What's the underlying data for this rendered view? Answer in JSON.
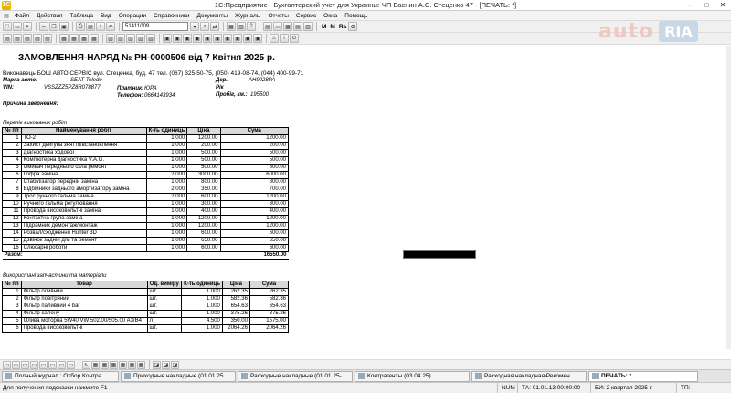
{
  "window": {
    "title": "1С:Предприятие - Бухгалтерский учет для Украины: ЧП Баснин А.С. Стеценко 47 - [ПЕЧАТЬ: *]"
  },
  "menu": [
    "Файл",
    "Действия",
    "Таблица",
    "Вид",
    "Операции",
    "Справочники",
    "Документы",
    "Журналы",
    "Отчеты",
    "Сервис",
    "Окна",
    "Помощь"
  ],
  "toolbar": {
    "search_value": "51411009",
    "font_m": "M",
    "font_m2": "M",
    "font_ra": "Ra"
  },
  "watermark": {
    "text1": "auto",
    "text2": "RIA"
  },
  "document": {
    "title": "ЗАМОВЛЕННЯ-НАРЯД  № РН-0000506  від 7 Квітня 2025 р.",
    "executor": "Виконавець БОШ АВТО СЕРВІС вул. Стеценка, буд. 47 тел. (067) 325-50-75, (050) 419-08-74, (044) 400-99-71",
    "car_label": "Марка авто:",
    "car_value": "SEAT Toledo",
    "vin_label": "VIN:",
    "vin_value": "VSSZZZ5PZ8R078877",
    "payer_label": "Платник:",
    "payer_value": "ЮРА",
    "phone_label": "Телефон:",
    "phone_value": "0664143934",
    "reg_label": "Дер.",
    "reg_value": "AH9028PA",
    "year_label": "Рік",
    "year_value": "",
    "mileage_label": "Пробіг, км.:",
    "mileage_value": "195500",
    "reason_label": "Причина звернення:",
    "works_caption": "Перелік виконаних робіт",
    "works_headers": [
      "№ пп",
      "Найменування робіт",
      "К-ть одиниць",
      "Ціна",
      "Сума"
    ],
    "works": [
      [
        "1",
        "ТО-2",
        "1.000",
        "1200.00",
        "1200.00"
      ],
      [
        "2",
        "Захист двигуна зняття/встановлення",
        "1.000",
        "200.00",
        "200.00"
      ],
      [
        "3",
        "Діагностика ходової",
        "1.000",
        "500.00",
        "500.00"
      ],
      [
        "4",
        "Комп'ютерна діагностика V.A.G.",
        "1.000",
        "500.00",
        "500.00"
      ],
      [
        "5",
        "Омивач переднього скла ремонт",
        "1.000",
        "500.00",
        "500.00"
      ],
      [
        "6",
        "Гофра заміна",
        "2.000",
        "3000.00",
        "6000.00"
      ],
      [
        "7",
        "Стабілізатор передній заміна",
        "1.000",
        "800.00",
        "800.00"
      ],
      [
        "8",
        "Відбійники заднього амортизатору заміна",
        "2.000",
        "350.00",
        "700.00"
      ],
      [
        "9",
        "Трос ручного гальма заміна",
        "2.000",
        "600.00",
        "1200.00"
      ],
      [
        "10",
        "Ручного гальма регулювання",
        "1.000",
        "300.00",
        "300.00"
      ],
      [
        "11",
        "Провода високовольтні заміна",
        "1.000",
        "400.00",
        "400.00"
      ],
      [
        "12",
        "Контактна група заміна",
        "1.000",
        "1200.00",
        "1200.00"
      ],
      [
        "13",
        "Підрамник демонтаж/монтаж",
        "1.000",
        "1200.00",
        "1200.00"
      ],
      [
        "14",
        "Розвал/сходження Hunter 3D",
        "1.000",
        "600.00",
        "600.00"
      ],
      [
        "15",
        "Дзвінок задній д/м та ремонт",
        "1.000",
        "650.00",
        "650.00"
      ],
      [
        "16",
        "Слюсарні роботи",
        "1.000",
        "600.00",
        "600.00"
      ]
    ],
    "works_total_label": "Разом:",
    "works_total": "16550.00",
    "parts_caption": "Використані запчастини та матеріали",
    "parts_headers": [
      "№ пп",
      "Товар",
      "Од. виміру",
      "К-ть одиниць",
      "Ціна",
      "Сума"
    ],
    "parts": [
      [
        "1",
        "Фільтр оливний",
        "шт.",
        "1.000",
        "262.35",
        "262.35"
      ],
      [
        "2",
        "Фільтр повітряний",
        "шт.",
        "1.000",
        "582.36",
        "582.36"
      ],
      [
        "3",
        "Фільтр паливний 4 bar",
        "шт.",
        "1.000",
        "654.63",
        "654.63"
      ],
      [
        "4",
        "Фільтр салону",
        "шт.",
        "1.000",
        "375.26",
        "375.26"
      ],
      [
        "5",
        "Олива моторна 5W40 VW 502.00/505.00 A3/B4",
        "л",
        "4.500",
        "350.00",
        "1575.00"
      ],
      [
        "6",
        "Провода високовольтні",
        "шт.",
        "1.000",
        "2064.26",
        "2064.26"
      ]
    ]
  },
  "taskbar": [
    "Полный журнал : Отбор Контра...",
    "Приходные накладные (01.01.25...",
    "Расходные накладные (01.01.25-...",
    "Контрагенты (03.04.25)",
    "Расходная накладная/Рекомен...",
    "ПЕЧАТЬ:  *"
  ],
  "status": {
    "hint": "Для получения подсказки нажмите F1",
    "num": "NUM",
    "ta": "ТА: 01.01.13  00:00:00",
    "bi": "БИ: 2 квартал 2025 г.",
    "tp": "ТП:"
  }
}
